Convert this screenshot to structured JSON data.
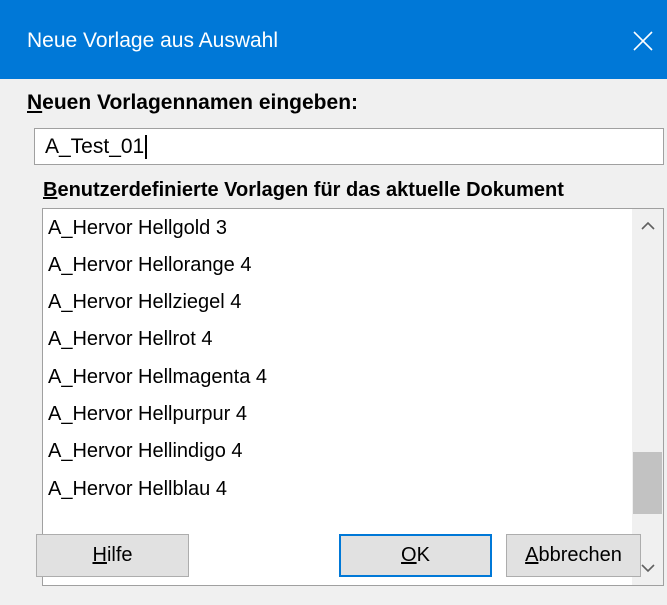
{
  "window": {
    "title": "Neue Vorlage aus Auswahl",
    "close_icon": "close-icon"
  },
  "name_section": {
    "label_first": "N",
    "label_rest": "euen Vorlagennamen eingeben:",
    "input_value": "A_Test_01"
  },
  "list_section": {
    "label_first": "B",
    "label_rest": "enutzerdefinierte Vorlagen für das aktuelle Dokument",
    "items": [
      "A_Hervor Hellgold 3",
      "A_Hervor Hellorange 4",
      "A_Hervor Hellziegel 4",
      "A_Hervor Hellrot 4",
      "A_Hervor Hellmagenta 4",
      "A_Hervor Hellpurpur 4",
      "A_Hervor Hellindigo 4",
      "A_Hervor Hellblau 4"
    ]
  },
  "buttons": {
    "help_mn": "H",
    "help_rest": "ilfe",
    "ok_mn": "O",
    "ok_rest": "K",
    "cancel_mn": "A",
    "cancel_rest": "bbrechen"
  },
  "colors": {
    "titlebar": "#0078d7",
    "dialog_bg": "#f0f0f0",
    "default_button_border": "#0078d7"
  }
}
